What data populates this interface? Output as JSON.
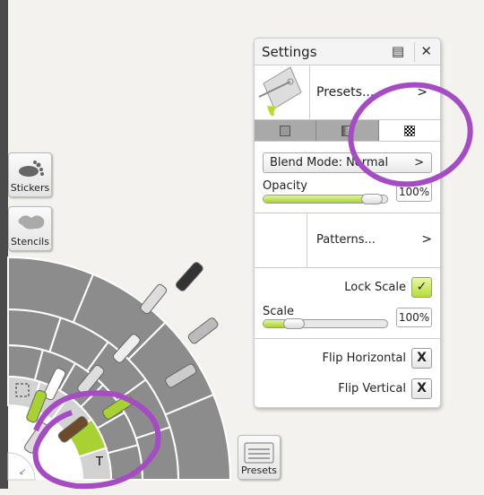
{
  "sidebar": {
    "stickers": "Stickers",
    "stencils": "Stencils",
    "presets": "Presets"
  },
  "settings": {
    "title": "Settings",
    "icons": [
      "list-icon",
      "close-icon"
    ],
    "presets_label": "Presets...",
    "presets_chevron": ">",
    "tabs": [
      "solid",
      "gradient",
      "pattern"
    ],
    "selected_tab": "pattern",
    "blend_mode": "Blend Mode: Normal",
    "blend_chevron": ">",
    "opacity_label": "Opacity",
    "opacity_value": "100%",
    "opacity_fraction": 0.95,
    "patterns_label": "Patterns...",
    "patterns_chevron": ">",
    "lock_scale_label": "Lock Scale",
    "lock_scale_mark": "✓",
    "scale_label": "Scale",
    "scale_value": "100%",
    "scale_fraction": 0.2,
    "flip_h_label": "Flip Horizontal",
    "flip_h_mark": "X",
    "flip_v_label": "Flip Vertical",
    "flip_v_mark": "X"
  },
  "tool_wheel": {
    "text_tool": "T",
    "selected_tool": "fill",
    "accent": "#a7d232"
  },
  "colors": {
    "accent": "#a7d232",
    "annotation": "#a54bc4"
  }
}
